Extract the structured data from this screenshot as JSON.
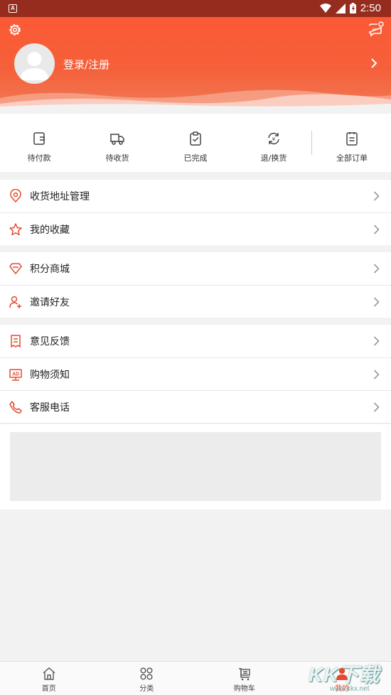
{
  "status_bar": {
    "time": "2:50"
  },
  "header": {
    "login_label": "登录/注册",
    "icons": {
      "settings": "gear-icon",
      "message": "chat-bubble-icon",
      "arrow": "chevron-right-icon"
    }
  },
  "orders": [
    {
      "label": "待付款",
      "icon": "wallet-icon"
    },
    {
      "label": "待收货",
      "icon": "truck-icon"
    },
    {
      "label": "已完成",
      "icon": "clipboard-check-icon"
    },
    {
      "label": "退/换货",
      "icon": "exchange-icon"
    },
    {
      "label": "全部订单",
      "icon": "order-list-icon"
    }
  ],
  "menu_groups": [
    [
      {
        "label": "收货地址管理",
        "icon": "location-pin-icon"
      },
      {
        "label": "我的收藏",
        "icon": "star-icon"
      }
    ],
    [
      {
        "label": "积分商城",
        "icon": "diamond-icon"
      },
      {
        "label": "邀请好友",
        "icon": "add-user-icon"
      }
    ],
    [
      {
        "label": "意见反馈",
        "icon": "feedback-icon"
      },
      {
        "label": "购物须知",
        "icon": "ad-screen-icon"
      },
      {
        "label": "客服电话",
        "icon": "phone-icon"
      }
    ]
  ],
  "tabbar": [
    {
      "label": "首页",
      "icon": "home-icon",
      "active": false
    },
    {
      "label": "分类",
      "icon": "grid-icon",
      "active": false
    },
    {
      "label": "购物车",
      "icon": "cart-icon",
      "active": false
    },
    {
      "label": "我的",
      "icon": "user-icon",
      "active": true
    }
  ],
  "colors": {
    "accent": "#f4512f",
    "icon_red": "#e34a2e",
    "background": "#f2f2f2"
  },
  "watermark": {
    "brand": "KK下载",
    "url": "www.kkx.net"
  }
}
